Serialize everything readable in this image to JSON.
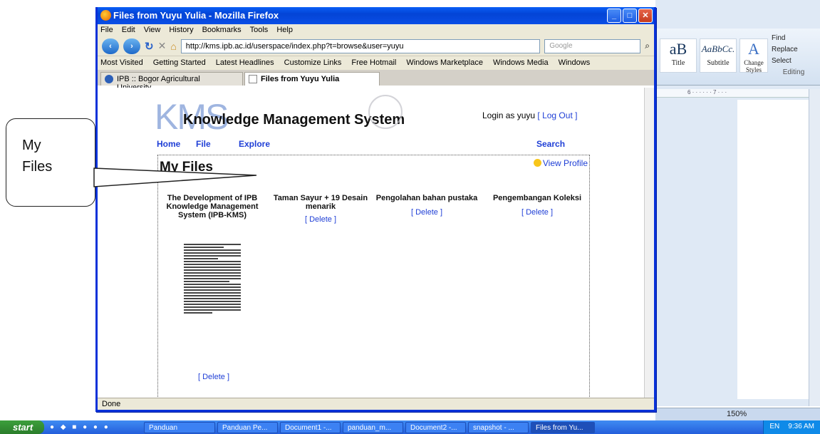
{
  "callout": {
    "line1": "My",
    "line2": "Files"
  },
  "word": {
    "styles": [
      {
        "sample": "aB",
        "label": "Title"
      },
      {
        "sample": "AaBbCc.",
        "label": "Subtitle"
      }
    ],
    "change_styles": "Change Styles",
    "editing": [
      "Find",
      "Replace",
      "Select",
      "Editing"
    ],
    "status": "150%"
  },
  "firefox": {
    "title": "Files from Yuyu Yulia - Mozilla Firefox",
    "menu": [
      "File",
      "Edit",
      "View",
      "History",
      "Bookmarks",
      "Tools",
      "Help"
    ],
    "url": "http://kms.ipb.ac.id/userspace/index.php?t=browse&user=yuyu",
    "search_placeholder": "Google",
    "bookmarks": [
      "Most Visited",
      "Getting Started",
      "Latest Headlines",
      "Customize Links",
      "Free Hotmail",
      "Windows Marketplace",
      "Windows Media",
      "Windows"
    ],
    "tabs": [
      {
        "label": "IPB :: Bogor Agricultural University"
      },
      {
        "label": "Files from Yuyu Yulia"
      }
    ],
    "status": "Done"
  },
  "page": {
    "logo": "KMS",
    "logo_sub": "Knowledge Management System",
    "login_text": "Login as yuyu",
    "logout": "[ Log Out ]",
    "nav": [
      "Home",
      "File",
      "Explore",
      "Search"
    ],
    "heading": "My Files",
    "view_profile": "View Profile",
    "files": [
      {
        "title": "The Development of IPB Knowledge Management System (IPB-KMS)",
        "delete": "[ Delete ]"
      },
      {
        "title": "Taman Sayur + 19 Desain menarik",
        "delete": "[ Delete ]"
      },
      {
        "title": "Pengolahan bahan pustaka",
        "delete": "[ Delete ]"
      },
      {
        "title": "Pengembangan Koleksi",
        "delete": "[ Delete ]"
      }
    ]
  },
  "taskbar": {
    "start": "start",
    "items": [
      "Panduan",
      "Panduan Pe...",
      "Document1 -...",
      "panduan_m...",
      "Document2 -...",
      "snapshot - ...",
      "Files from Yu..."
    ],
    "lang": "EN",
    "time": "9:36 AM"
  }
}
